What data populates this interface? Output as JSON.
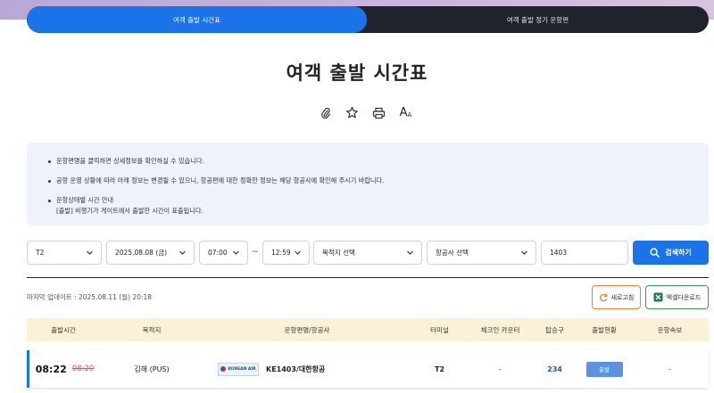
{
  "tabs": [
    {
      "label": "여객 출발 시간표",
      "active": true
    },
    {
      "label": "여객 출발 정기 운항편",
      "active": false
    }
  ],
  "page_title": "여객 출발 시간표",
  "tools": [
    "paperclip-icon",
    "star-icon",
    "print-icon",
    "font-size-icon"
  ],
  "font_size_label": {
    "big": "A",
    "small": "A"
  },
  "notice": {
    "items": [
      "운항편명을 클릭하면 상세정보를 확인하실 수 있습니다.",
      "공항 운영 상황에 따라 아래 정보는 변경될 수 있으니, 항공편에 대한 정확한 정보는 해당 항공사에 확인해 주시기 바랍니다."
    ],
    "status_guide_title": "운항상태별 시간 안내",
    "status_guide_text": "[출발] 비행기가 게이트에서 출발한 시간이 표출됩니다."
  },
  "filters": {
    "terminal": "T2",
    "date": "2025.08.08 (금)",
    "time_from": "07:00",
    "tilde": "~",
    "time_to": "12:59",
    "destination": "목적지 선택",
    "airline": "항공사 선택",
    "flight_no": "1403",
    "search_label": "검색하기"
  },
  "last_updated": "마지막 업데이트 : 2025.08.11 (월) 20:18",
  "buttons": {
    "refresh": "새로고침",
    "excel": "엑셀다운로드"
  },
  "table": {
    "headers": [
      "출발시간",
      "목적지",
      "운항편명/항공사",
      "터미널",
      "체크인 카운터",
      "탑승구",
      "출발현황",
      "운항속보"
    ],
    "rows": [
      {
        "time": "08:22",
        "scheduled": "08:20",
        "destination": "김해 (PUS)",
        "airline_logo": "KOREAN AIR",
        "flight": "KE1403/대한항공",
        "terminal": "T2",
        "checkin": "-",
        "gate": "234",
        "status": "출발",
        "news": "-"
      }
    ]
  },
  "colors": {
    "accent": "#1a73e8",
    "header_bg": "#faf1d6",
    "notice_bg": "#eef2fa"
  }
}
